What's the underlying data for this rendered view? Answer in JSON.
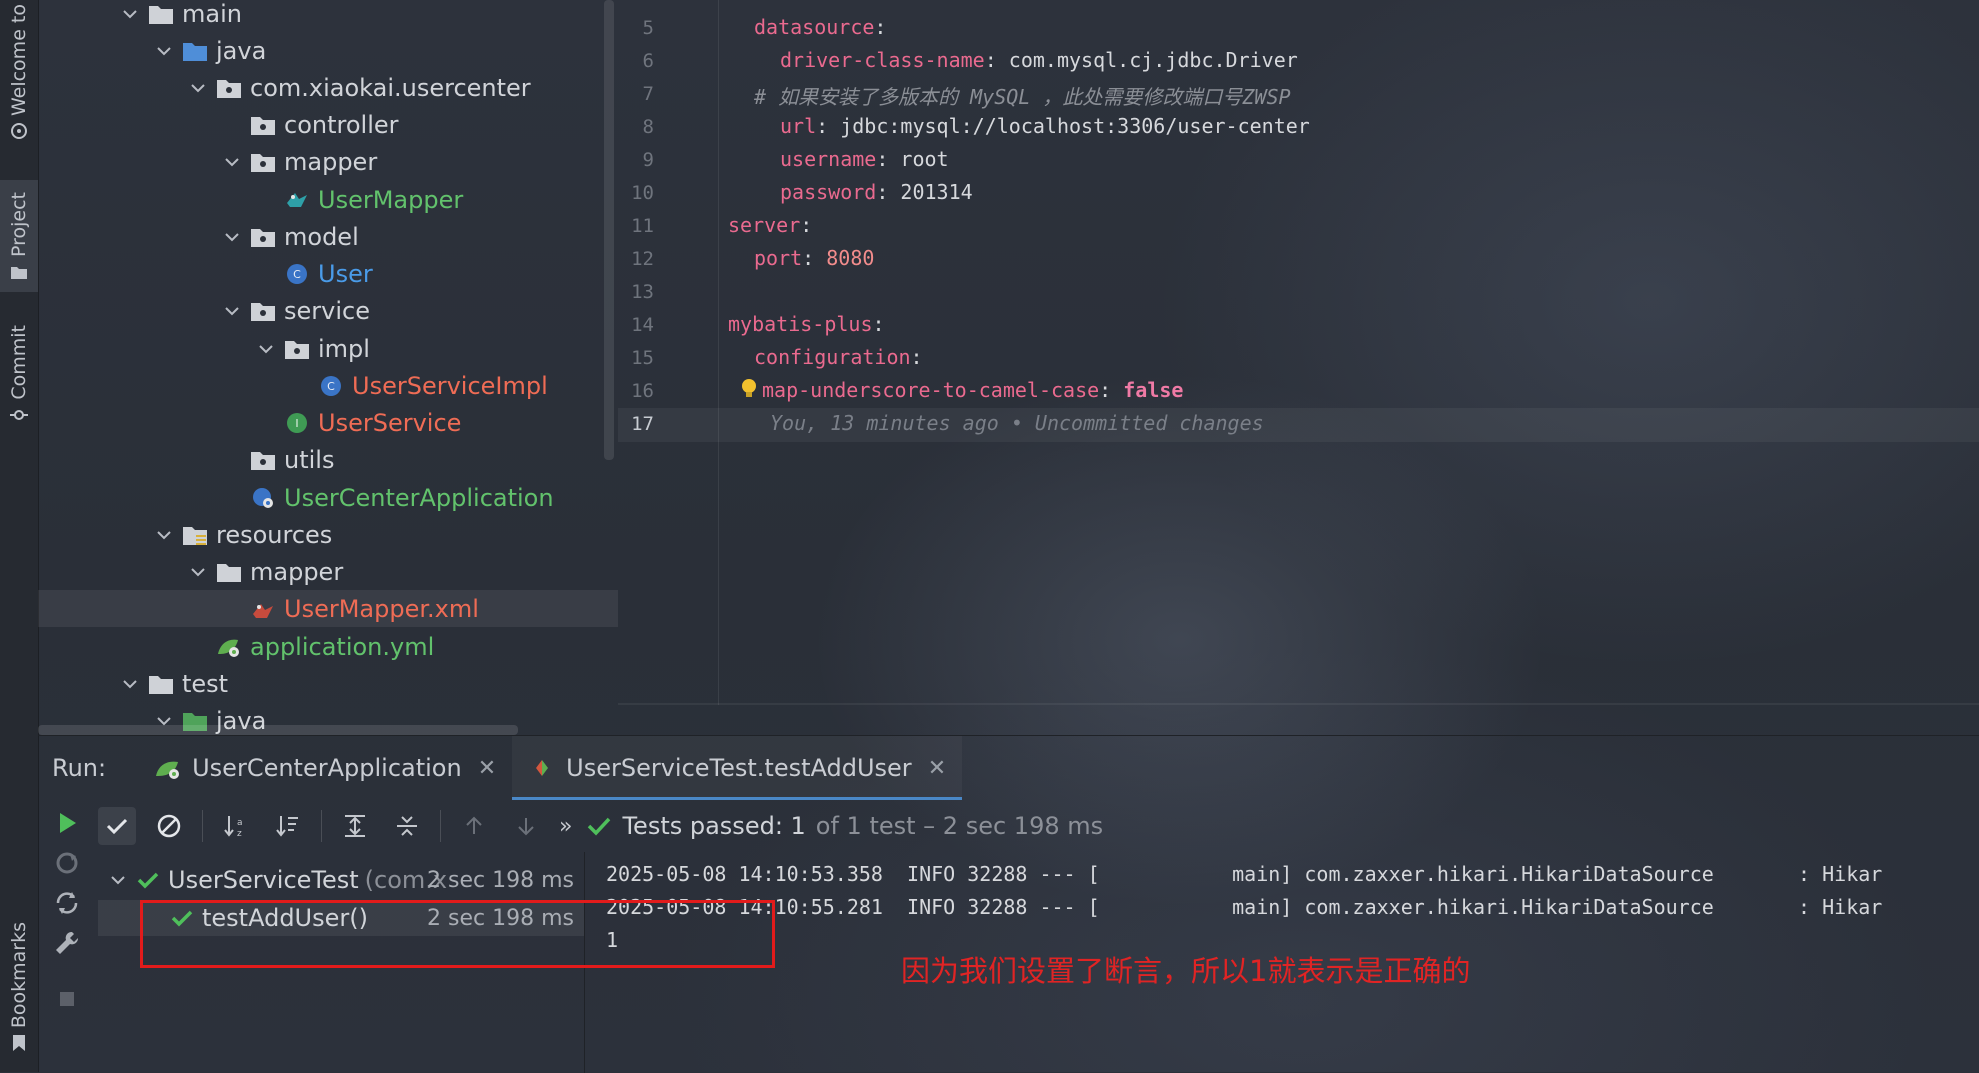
{
  "stripe": {
    "welcome_label": "Welcome to",
    "project_label": "Project",
    "commit_label": "Commit",
    "bookmarks_label": "Bookmarks"
  },
  "tree": {
    "items": [
      {
        "label": "main"
      },
      {
        "label": "java"
      },
      {
        "label": "com.xiaokai.usercenter"
      },
      {
        "label": "controller"
      },
      {
        "label": "mapper"
      },
      {
        "label": "UserMapper"
      },
      {
        "label": "model"
      },
      {
        "label": "User"
      },
      {
        "label": "service"
      },
      {
        "label": "impl"
      },
      {
        "label": "UserServiceImpl"
      },
      {
        "label": "UserService"
      },
      {
        "label": "utils"
      },
      {
        "label": "UserCenterApplication"
      },
      {
        "label": "resources"
      },
      {
        "label": "mapper"
      },
      {
        "label": "UserMapper.xml"
      },
      {
        "label": "application.yml"
      },
      {
        "label": "test"
      },
      {
        "label": "java"
      }
    ]
  },
  "editor": {
    "line_numbers": [
      "5",
      "6",
      "7",
      "8",
      "9",
      "10",
      "11",
      "12",
      "13",
      "14",
      "15",
      "16",
      "17"
    ],
    "lines": {
      "l5_key": "datasource",
      "l6_key": "driver-class-name",
      "l6_val": "com.mysql.cj.jdbc.Driver",
      "l7_comment": "# 如果安装了多版本的 MySQL ，此处需要修改端口号ZWSP",
      "l8_key": "url",
      "l8_val": "jdbc:mysql://localhost:3306/user-center",
      "l9_key": "username",
      "l9_val": "root",
      "l10_key": "password",
      "l10_val": "201314",
      "l11_key": "server",
      "l12_key": "port",
      "l12_val": "8080",
      "l14_key": "mybatis-plus",
      "l15_key": "configuration",
      "l16_key": "map-underscore-to-camel-case",
      "l16_val": "false",
      "l17_blame": "You, 13 minutes ago • Uncommitted changes"
    }
  },
  "run": {
    "label": "Run:",
    "tabs": [
      {
        "label": "UserCenterApplication"
      },
      {
        "label": "UserServiceTest.testAddUser"
      }
    ],
    "toolbar": {
      "more": "»",
      "tests_passed": "Tests passed: 1",
      "tests_detail": "of 1 test – 2 sec 198 ms"
    },
    "test_tree": {
      "root_name": "UserServiceTest",
      "root_pkg": "(com.x",
      "root_time": "2 sec 198 ms",
      "child_name": "testAddUser()",
      "child_time": "2 sec 198 ms"
    },
    "console": [
      "2025-05-08 14:10:53.358  INFO 32288 --- [           main] com.zaxxer.hikari.HikariDataSource       : Hikar",
      "2025-05-08 14:10:55.281  INFO 32288 --- [           main] com.zaxxer.hikari.HikariDataSource       : Hikar",
      "1"
    ]
  },
  "annotation": {
    "note": "因为我们设置了断言，所以1就表示是正确的"
  },
  "colors": {
    "red_annotation": "#e21b1b",
    "green_text": "#62c26c",
    "orange_text": "#ef6c55",
    "yaml_key": "#ea6a8f"
  }
}
